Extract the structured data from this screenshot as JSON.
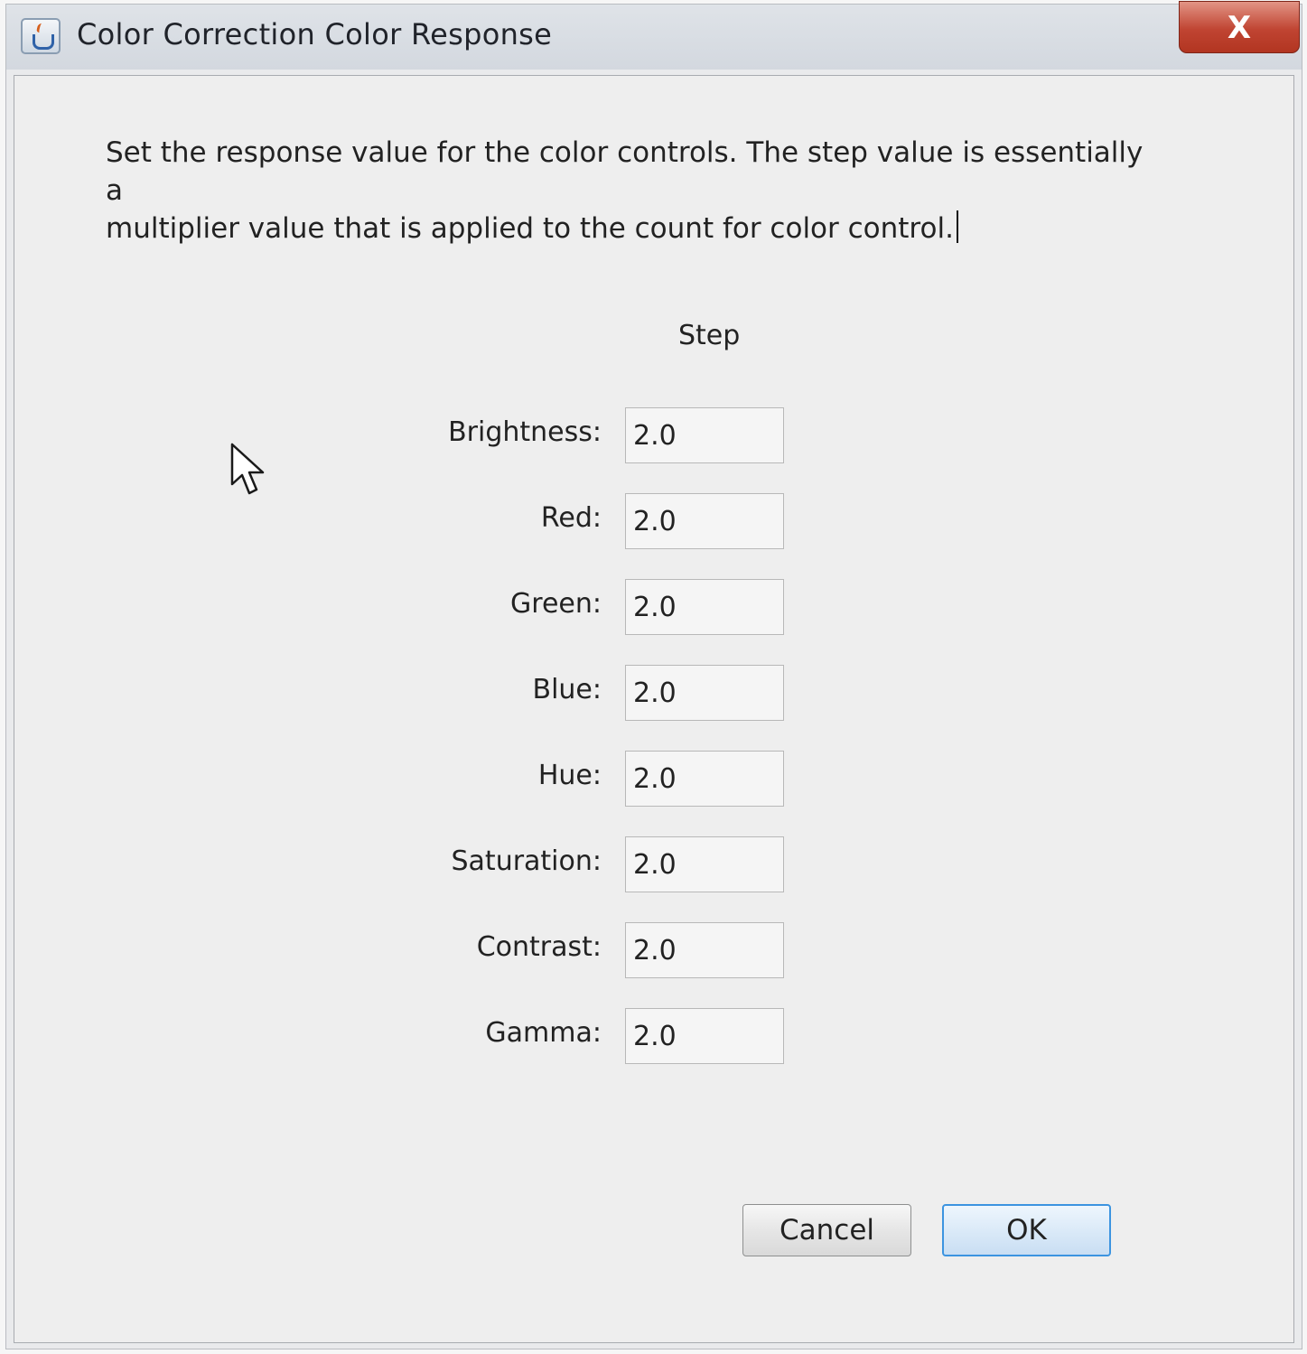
{
  "window": {
    "title": "Color Correction Color Response",
    "close_label": "X"
  },
  "description": {
    "line1": "Set the response value for the color controls.  The step value is essentially a",
    "line2": "multiplier value that is applied to the count for color control."
  },
  "column_header": "Step",
  "fields": [
    {
      "label": "Brightness:",
      "value": "2.0"
    },
    {
      "label": "Red:",
      "value": "2.0"
    },
    {
      "label": "Green:",
      "value": "2.0"
    },
    {
      "label": "Blue:",
      "value": "2.0"
    },
    {
      "label": "Hue:",
      "value": "2.0"
    },
    {
      "label": "Saturation:",
      "value": "2.0"
    },
    {
      "label": "Contrast:",
      "value": "2.0"
    },
    {
      "label": "Gamma:",
      "value": "2.0"
    }
  ],
  "buttons": {
    "cancel_label": "Cancel",
    "ok_label": "OK"
  },
  "icons": {
    "app": "java-cup-icon",
    "close": "close-icon",
    "cursor": "mouse-pointer-icon"
  },
  "colors": {
    "close_button": "#c04432",
    "ok_border": "#3c94e0"
  }
}
